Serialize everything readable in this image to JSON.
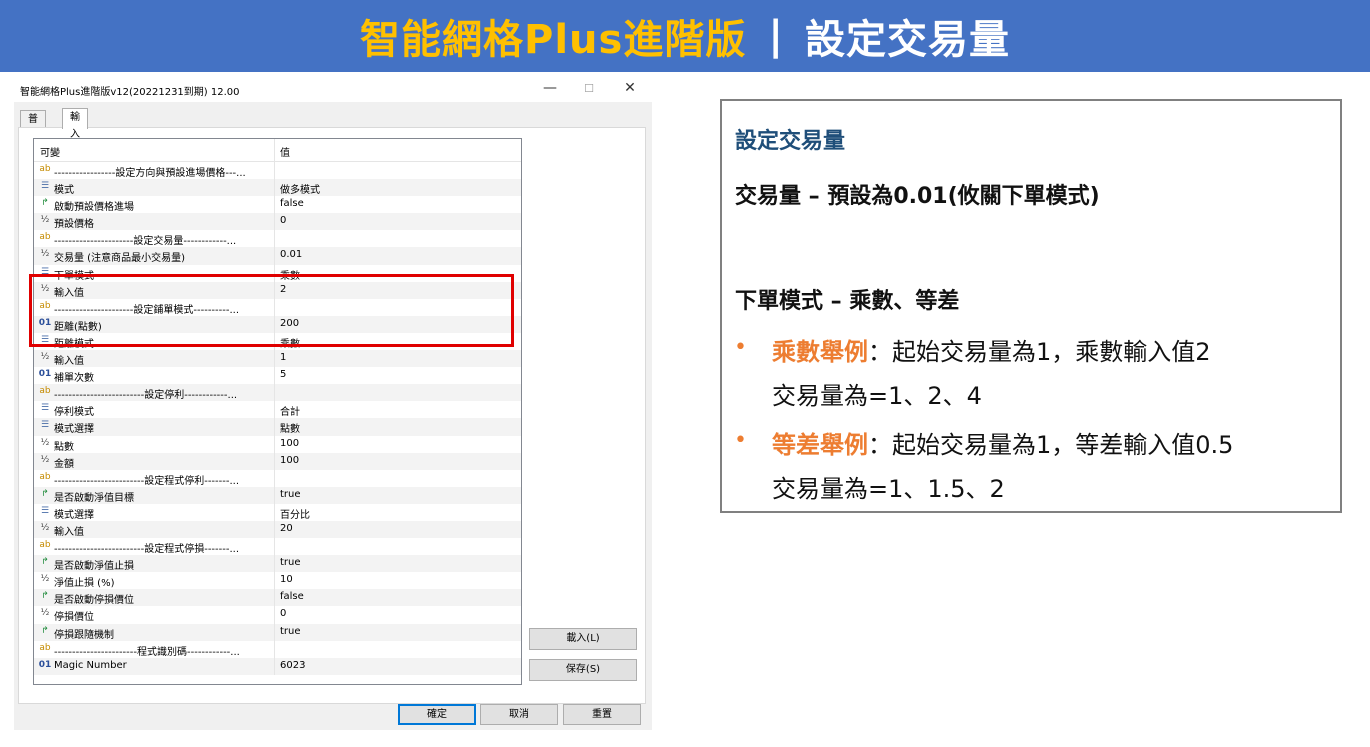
{
  "banner": {
    "title": "智能網格Plus進階版",
    "separator": "|",
    "subtitle": "設定交易量"
  },
  "dialog": {
    "window_title": "智能網格Plus進階版v12(20221231到期) 12.00",
    "minimize": "—",
    "maximize": "☐",
    "close": "✕",
    "tabs": [
      "普通",
      "輸入"
    ],
    "active_tab": "輸入",
    "grid_headers": {
      "variable": "可變",
      "value": "值"
    },
    "rows": [
      {
        "icon": "ab",
        "type": "string",
        "name": "-----------------設定方向與預設進場價格---...",
        "value": ""
      },
      {
        "icon": "☰",
        "type": "enum",
        "name": "模式",
        "value": "做多模式"
      },
      {
        "icon": "↱",
        "type": "bool",
        "name": "啟動預設價格進場",
        "value": "false"
      },
      {
        "icon": "½",
        "type": "double",
        "name": "預設價格",
        "value": "0"
      },
      {
        "icon": "ab",
        "type": "string",
        "name": "----------------------設定交易量------------...",
        "value": ""
      },
      {
        "icon": "½",
        "type": "double",
        "name": "交易量 (注意商品最小交易量)",
        "value": "0.01"
      },
      {
        "icon": "☰",
        "type": "enum",
        "name": "下單模式",
        "value": "乘數"
      },
      {
        "icon": "½",
        "type": "double",
        "name": "輸入值",
        "value": "2"
      },
      {
        "icon": "ab",
        "type": "string",
        "name": "----------------------設定鋪單模式----------...",
        "value": ""
      },
      {
        "icon": "01",
        "type": "int",
        "name": "距離(點數)",
        "value": "200"
      },
      {
        "icon": "☰",
        "type": "enum",
        "name": "距離模式",
        "value": "乘數"
      },
      {
        "icon": "½",
        "type": "double",
        "name": "輸入值",
        "value": "1"
      },
      {
        "icon": "01",
        "type": "int",
        "name": "補單次數",
        "value": "5"
      },
      {
        "icon": "ab",
        "type": "string",
        "name": "-------------------------設定停利------------...",
        "value": ""
      },
      {
        "icon": "☰",
        "type": "enum",
        "name": "停利模式",
        "value": "合計"
      },
      {
        "icon": "☰",
        "type": "enum",
        "name": "模式選擇",
        "value": "點數"
      },
      {
        "icon": "½",
        "type": "double",
        "name": "點數",
        "value": "100"
      },
      {
        "icon": "½",
        "type": "double",
        "name": "金額",
        "value": "100"
      },
      {
        "icon": "ab",
        "type": "string",
        "name": "-------------------------設定程式停利-------...",
        "value": ""
      },
      {
        "icon": "↱",
        "type": "bool",
        "name": "是否啟動淨值目標",
        "value": "true"
      },
      {
        "icon": "☰",
        "type": "enum",
        "name": "模式選擇",
        "value": "百分比"
      },
      {
        "icon": "½",
        "type": "double",
        "name": "輸入值",
        "value": "20"
      },
      {
        "icon": "ab",
        "type": "string",
        "name": "-------------------------設定程式停損-------...",
        "value": ""
      },
      {
        "icon": "↱",
        "type": "bool",
        "name": "是否啟動淨值止損",
        "value": "true"
      },
      {
        "icon": "½",
        "type": "double",
        "name": "淨值止損 (%)",
        "value": "10"
      },
      {
        "icon": "↱",
        "type": "bool",
        "name": "是否啟動停損價位",
        "value": "false"
      },
      {
        "icon": "½",
        "type": "double",
        "name": "停損價位",
        "value": "0"
      },
      {
        "icon": "↱",
        "type": "bool",
        "name": "停損跟隨機制",
        "value": "true"
      },
      {
        "icon": "ab",
        "type": "string",
        "name": "-----------------------程式識別碼------------...",
        "value": ""
      },
      {
        "icon": "01",
        "type": "int",
        "name": "Magic Number",
        "value": "6023"
      }
    ],
    "load_button": "載入(L)",
    "save_button": "保存(S)",
    "ok_button": "確定",
    "cancel_button": "取消",
    "reset_button": "重置"
  },
  "info": {
    "title": "設定交易量",
    "line1": "交易量 – 預設為0.01(攸關下單模式)",
    "line2": "下單模式 – 乘數、等差",
    "bullet": "•",
    "example1_key": "乘數舉例",
    "example1_text": "：起始交易量為1，乘數輸入值2",
    "example1_result": "交易量為=1、2、4",
    "example2_key": "等差舉例",
    "example2_text": "：起始交易量為1，等差輸入值0.5",
    "example2_result": "交易量為=1、1.5、2"
  },
  "colors": {
    "banner_bg": "#4472c4",
    "banner_title": "#ffc000",
    "highlight_border": "#e00000",
    "info_title": "#1f4e79",
    "example_key": "#ed7d31"
  }
}
